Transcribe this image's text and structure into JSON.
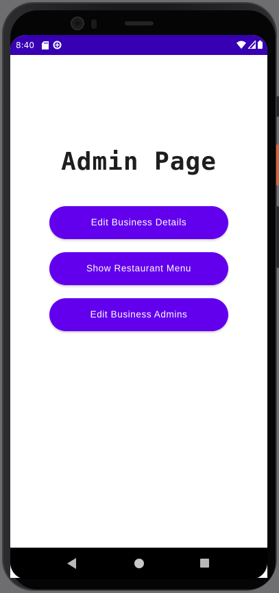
{
  "status_bar": {
    "time": "8:40",
    "background_color": "#3700b3",
    "left_icons": [
      "sd-card-icon",
      "data-saver-icon"
    ],
    "right_icons": [
      "wifi-icon",
      "cell-signal-icon",
      "battery-icon"
    ]
  },
  "main": {
    "title": "Admin Page",
    "buttons": [
      {
        "label": "Edit Business Details"
      },
      {
        "label": "Show Restaurant Menu"
      },
      {
        "label": "Edit Business Admins"
      }
    ],
    "button_color": "#6200ee"
  },
  "nav_bar": {
    "icons": [
      "back-icon",
      "home-icon",
      "recents-icon"
    ]
  }
}
